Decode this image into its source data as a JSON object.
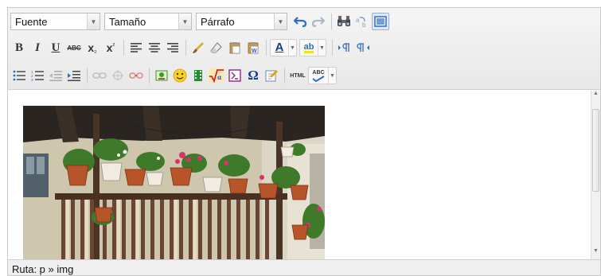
{
  "toolbar": {
    "font_select": {
      "value": "Fuente"
    },
    "size_select": {
      "value": "Tamaño"
    },
    "format_select": {
      "value": "Párrafo"
    },
    "buttons": {
      "bold": "B",
      "italic": "I",
      "underline": "U",
      "strikethrough": "ABC",
      "subscript": "x",
      "subscript_mark": "₂",
      "superscript": "x",
      "superscript_mark": "²",
      "font_color": "A",
      "highlight": "ab",
      "omega": "Ω",
      "html": "HTML",
      "spellcheck": "ABC"
    }
  },
  "editor": {
    "image": {
      "subject": "balcony-with-flower-pots"
    }
  },
  "status": {
    "path_text": "Ruta: p » img"
  },
  "colors": {
    "toolbar_bg": "#ececec",
    "accent_blue": "#2e6cc4"
  }
}
